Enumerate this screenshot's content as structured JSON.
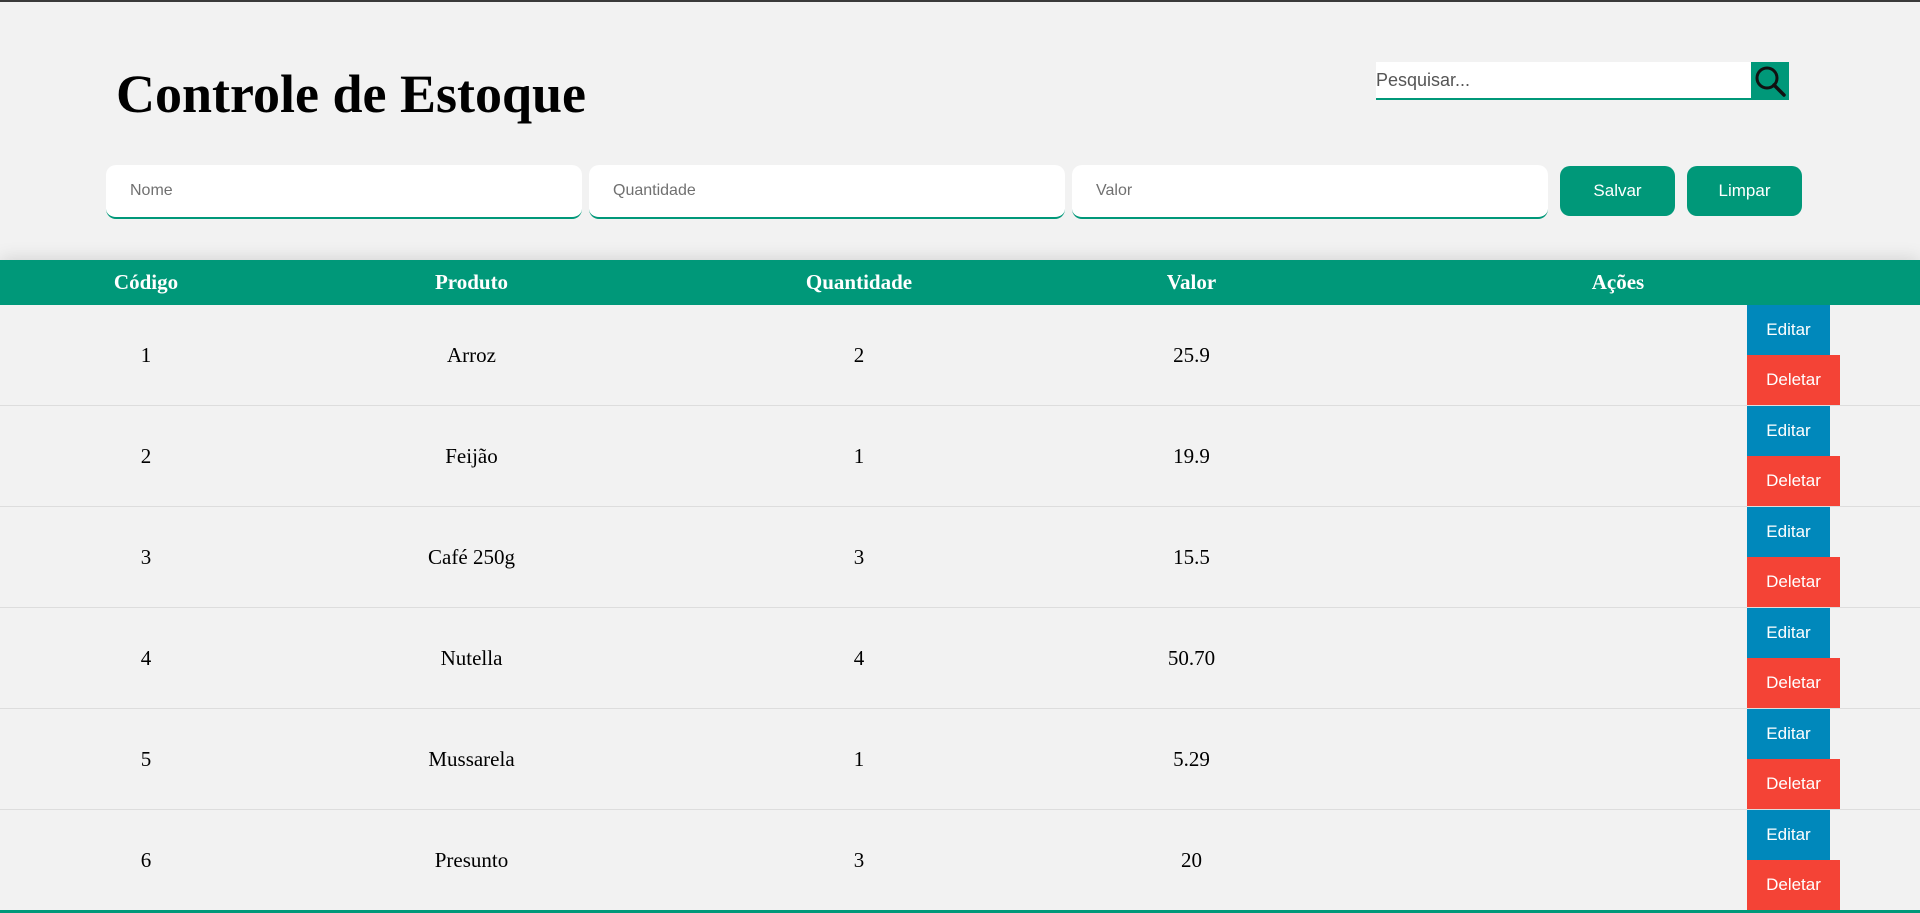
{
  "header": {
    "title": "Controle de Estoque"
  },
  "search": {
    "placeholder": "Pesquisar...",
    "icon": "search-icon"
  },
  "form": {
    "nome_placeholder": "Nome",
    "quantidade_placeholder": "Quantidade",
    "valor_placeholder": "Valor",
    "save_label": "Salvar",
    "clear_label": "Limpar"
  },
  "table": {
    "columns": [
      "Código",
      "Produto",
      "Quantidade",
      "Valor",
      "Ações"
    ],
    "rows": [
      {
        "codigo": "1",
        "produto": "Arroz",
        "quantidade": "2",
        "valor": "25.9",
        "edit_label": "Editar",
        "delete_label": "Deletar"
      },
      {
        "codigo": "2",
        "produto": "Feijão",
        "quantidade": "1",
        "valor": "19.9",
        "edit_label": "Editar",
        "delete_label": "Deletar"
      },
      {
        "codigo": "3",
        "produto": "Café 250g",
        "quantidade": "3",
        "valor": "15.5",
        "edit_label": "Editar",
        "delete_label": "Deletar"
      },
      {
        "codigo": "4",
        "produto": "Nutella",
        "quantidade": "4",
        "valor": "50.70",
        "edit_label": "Editar",
        "delete_label": "Deletar"
      },
      {
        "codigo": "5",
        "produto": "Mussarela",
        "quantidade": "1",
        "valor": "5.29",
        "edit_label": "Editar",
        "delete_label": "Deletar"
      },
      {
        "codigo": "6",
        "produto": "Presunto",
        "quantidade": "3",
        "valor": "20",
        "edit_label": "Editar",
        "delete_label": "Deletar"
      }
    ]
  },
  "colors": {
    "accent": "#009879",
    "edit": "#0088bb",
    "delete": "#f44336",
    "background": "#f2f2f2"
  }
}
